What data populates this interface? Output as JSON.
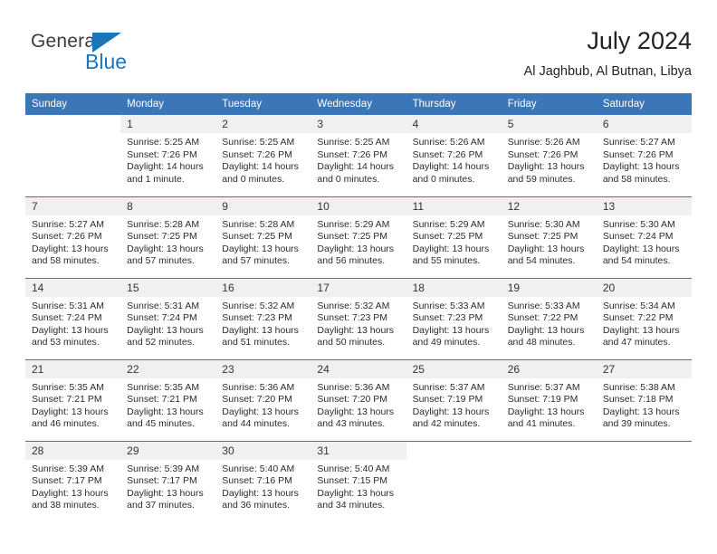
{
  "brand": {
    "name_part1": "General",
    "name_part2": "Blue",
    "triangle_color": "#1b75bb",
    "blue_color": "#1b75bb"
  },
  "header": {
    "title": "July 2024",
    "subtitle": "Al Jaghbub, Al Butnan, Libya"
  },
  "theme": {
    "header_blue": "#3a76b8",
    "daynum_band": "#f0f0f0",
    "text": "#222222"
  },
  "calendar": {
    "weekday_headers": [
      "Sunday",
      "Monday",
      "Tuesday",
      "Wednesday",
      "Thursday",
      "Friday",
      "Saturday"
    ],
    "labels": {
      "sunrise": "Sunrise:",
      "sunset": "Sunset:",
      "daylight": "Daylight:"
    },
    "weeks": [
      [
        {
          "day": "",
          "blank": true,
          "sunrise": "",
          "sunset": "",
          "daylight1": "",
          "daylight2": ""
        },
        {
          "day": "1",
          "sunrise": "Sunrise: 5:25 AM",
          "sunset": "Sunset: 7:26 PM",
          "daylight1": "Daylight: 14 hours",
          "daylight2": "and 1 minute."
        },
        {
          "day": "2",
          "sunrise": "Sunrise: 5:25 AM",
          "sunset": "Sunset: 7:26 PM",
          "daylight1": "Daylight: 14 hours",
          "daylight2": "and 0 minutes."
        },
        {
          "day": "3",
          "sunrise": "Sunrise: 5:25 AM",
          "sunset": "Sunset: 7:26 PM",
          "daylight1": "Daylight: 14 hours",
          "daylight2": "and 0 minutes."
        },
        {
          "day": "4",
          "sunrise": "Sunrise: 5:26 AM",
          "sunset": "Sunset: 7:26 PM",
          "daylight1": "Daylight: 14 hours",
          "daylight2": "and 0 minutes."
        },
        {
          "day": "5",
          "sunrise": "Sunrise: 5:26 AM",
          "sunset": "Sunset: 7:26 PM",
          "daylight1": "Daylight: 13 hours",
          "daylight2": "and 59 minutes."
        },
        {
          "day": "6",
          "sunrise": "Sunrise: 5:27 AM",
          "sunset": "Sunset: 7:26 PM",
          "daylight1": "Daylight: 13 hours",
          "daylight2": "and 58 minutes."
        }
      ],
      [
        {
          "day": "7",
          "sunrise": "Sunrise: 5:27 AM",
          "sunset": "Sunset: 7:26 PM",
          "daylight1": "Daylight: 13 hours",
          "daylight2": "and 58 minutes."
        },
        {
          "day": "8",
          "sunrise": "Sunrise: 5:28 AM",
          "sunset": "Sunset: 7:25 PM",
          "daylight1": "Daylight: 13 hours",
          "daylight2": "and 57 minutes."
        },
        {
          "day": "9",
          "sunrise": "Sunrise: 5:28 AM",
          "sunset": "Sunset: 7:25 PM",
          "daylight1": "Daylight: 13 hours",
          "daylight2": "and 57 minutes."
        },
        {
          "day": "10",
          "sunrise": "Sunrise: 5:29 AM",
          "sunset": "Sunset: 7:25 PM",
          "daylight1": "Daylight: 13 hours",
          "daylight2": "and 56 minutes."
        },
        {
          "day": "11",
          "sunrise": "Sunrise: 5:29 AM",
          "sunset": "Sunset: 7:25 PM",
          "daylight1": "Daylight: 13 hours",
          "daylight2": "and 55 minutes."
        },
        {
          "day": "12",
          "sunrise": "Sunrise: 5:30 AM",
          "sunset": "Sunset: 7:25 PM",
          "daylight1": "Daylight: 13 hours",
          "daylight2": "and 54 minutes."
        },
        {
          "day": "13",
          "sunrise": "Sunrise: 5:30 AM",
          "sunset": "Sunset: 7:24 PM",
          "daylight1": "Daylight: 13 hours",
          "daylight2": "and 54 minutes."
        }
      ],
      [
        {
          "day": "14",
          "sunrise": "Sunrise: 5:31 AM",
          "sunset": "Sunset: 7:24 PM",
          "daylight1": "Daylight: 13 hours",
          "daylight2": "and 53 minutes."
        },
        {
          "day": "15",
          "sunrise": "Sunrise: 5:31 AM",
          "sunset": "Sunset: 7:24 PM",
          "daylight1": "Daylight: 13 hours",
          "daylight2": "and 52 minutes."
        },
        {
          "day": "16",
          "sunrise": "Sunrise: 5:32 AM",
          "sunset": "Sunset: 7:23 PM",
          "daylight1": "Daylight: 13 hours",
          "daylight2": "and 51 minutes."
        },
        {
          "day": "17",
          "sunrise": "Sunrise: 5:32 AM",
          "sunset": "Sunset: 7:23 PM",
          "daylight1": "Daylight: 13 hours",
          "daylight2": "and 50 minutes."
        },
        {
          "day": "18",
          "sunrise": "Sunrise: 5:33 AM",
          "sunset": "Sunset: 7:23 PM",
          "daylight1": "Daylight: 13 hours",
          "daylight2": "and 49 minutes."
        },
        {
          "day": "19",
          "sunrise": "Sunrise: 5:33 AM",
          "sunset": "Sunset: 7:22 PM",
          "daylight1": "Daylight: 13 hours",
          "daylight2": "and 48 minutes."
        },
        {
          "day": "20",
          "sunrise": "Sunrise: 5:34 AM",
          "sunset": "Sunset: 7:22 PM",
          "daylight1": "Daylight: 13 hours",
          "daylight2": "and 47 minutes."
        }
      ],
      [
        {
          "day": "21",
          "sunrise": "Sunrise: 5:35 AM",
          "sunset": "Sunset: 7:21 PM",
          "daylight1": "Daylight: 13 hours",
          "daylight2": "and 46 minutes."
        },
        {
          "day": "22",
          "sunrise": "Sunrise: 5:35 AM",
          "sunset": "Sunset: 7:21 PM",
          "daylight1": "Daylight: 13 hours",
          "daylight2": "and 45 minutes."
        },
        {
          "day": "23",
          "sunrise": "Sunrise: 5:36 AM",
          "sunset": "Sunset: 7:20 PM",
          "daylight1": "Daylight: 13 hours",
          "daylight2": "and 44 minutes."
        },
        {
          "day": "24",
          "sunrise": "Sunrise: 5:36 AM",
          "sunset": "Sunset: 7:20 PM",
          "daylight1": "Daylight: 13 hours",
          "daylight2": "and 43 minutes."
        },
        {
          "day": "25",
          "sunrise": "Sunrise: 5:37 AM",
          "sunset": "Sunset: 7:19 PM",
          "daylight1": "Daylight: 13 hours",
          "daylight2": "and 42 minutes."
        },
        {
          "day": "26",
          "sunrise": "Sunrise: 5:37 AM",
          "sunset": "Sunset: 7:19 PM",
          "daylight1": "Daylight: 13 hours",
          "daylight2": "and 41 minutes."
        },
        {
          "day": "27",
          "sunrise": "Sunrise: 5:38 AM",
          "sunset": "Sunset: 7:18 PM",
          "daylight1": "Daylight: 13 hours",
          "daylight2": "and 39 minutes."
        }
      ],
      [
        {
          "day": "28",
          "sunrise": "Sunrise: 5:39 AM",
          "sunset": "Sunset: 7:17 PM",
          "daylight1": "Daylight: 13 hours",
          "daylight2": "and 38 minutes."
        },
        {
          "day": "29",
          "sunrise": "Sunrise: 5:39 AM",
          "sunset": "Sunset: 7:17 PM",
          "daylight1": "Daylight: 13 hours",
          "daylight2": "and 37 minutes."
        },
        {
          "day": "30",
          "sunrise": "Sunrise: 5:40 AM",
          "sunset": "Sunset: 7:16 PM",
          "daylight1": "Daylight: 13 hours",
          "daylight2": "and 36 minutes."
        },
        {
          "day": "31",
          "sunrise": "Sunrise: 5:40 AM",
          "sunset": "Sunset: 7:15 PM",
          "daylight1": "Daylight: 13 hours",
          "daylight2": "and 34 minutes."
        },
        {
          "day": "",
          "blank": true,
          "sunrise": "",
          "sunset": "",
          "daylight1": "",
          "daylight2": ""
        },
        {
          "day": "",
          "blank": true,
          "sunrise": "",
          "sunset": "",
          "daylight1": "",
          "daylight2": ""
        },
        {
          "day": "",
          "blank": true,
          "sunrise": "",
          "sunset": "",
          "daylight1": "",
          "daylight2": ""
        }
      ]
    ]
  }
}
